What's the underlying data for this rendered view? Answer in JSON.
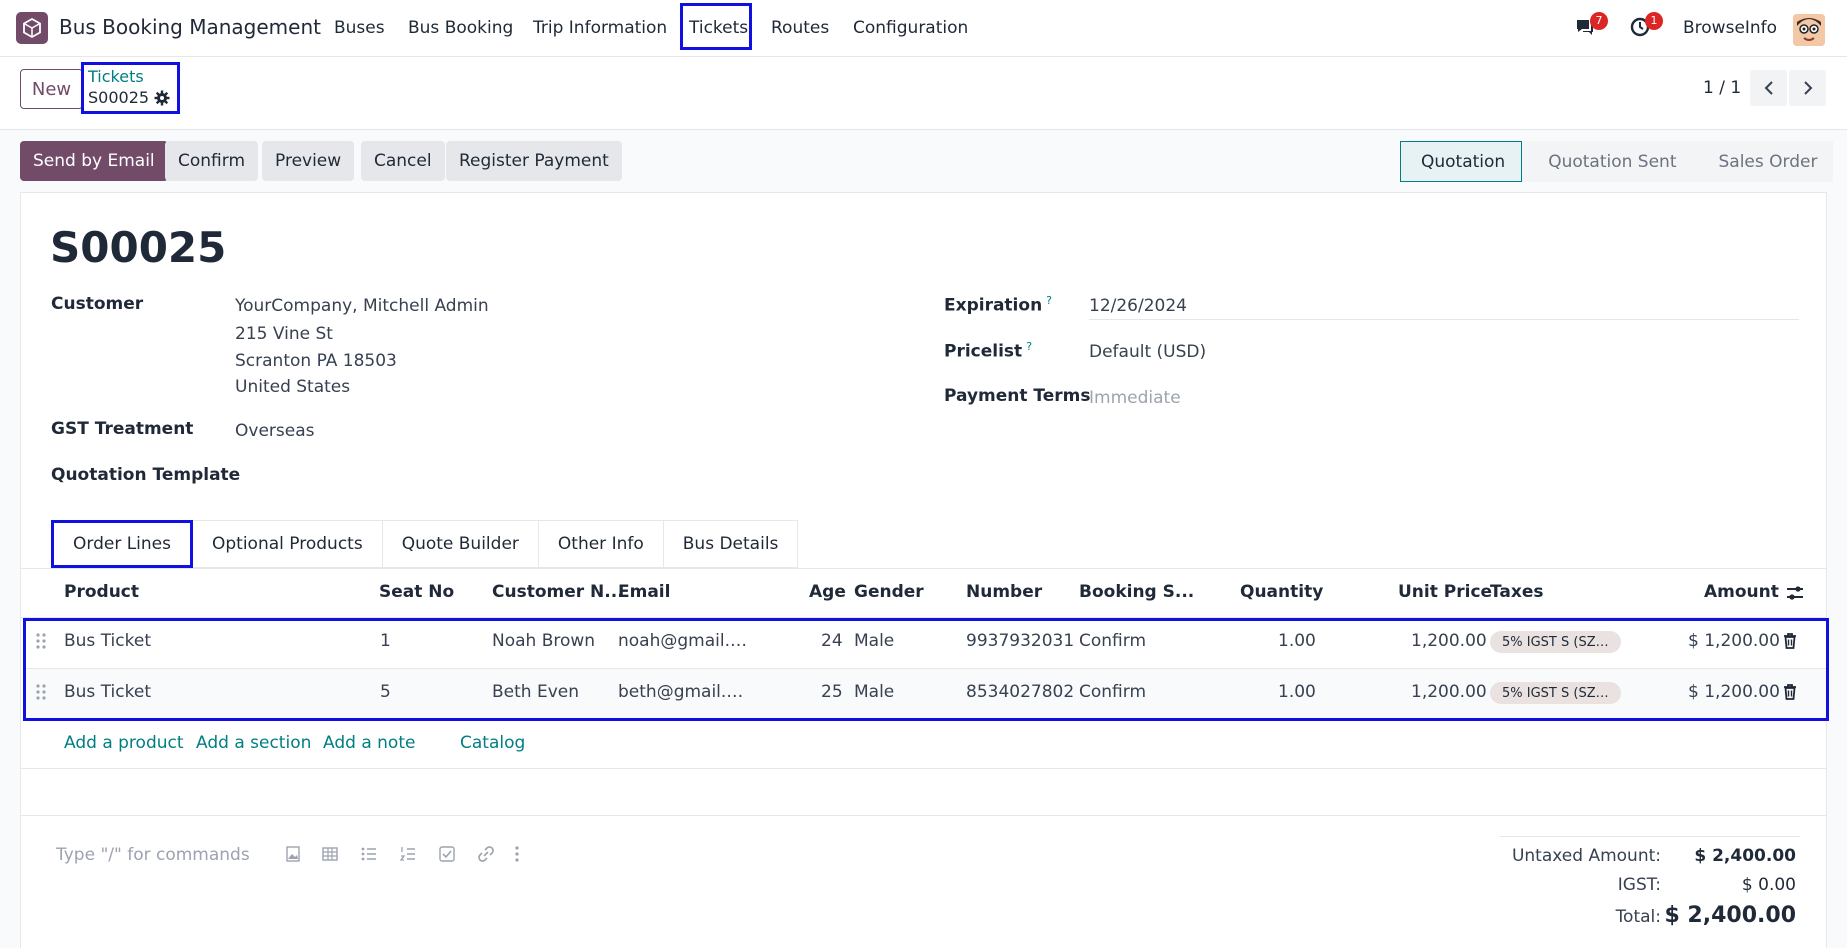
{
  "app": {
    "title": "Bus Booking Management",
    "menu": [
      "Buses",
      "Bus Booking",
      "Trip Information",
      "Tickets",
      "Routes",
      "Configuration"
    ],
    "messages_badge": "7",
    "activities_badge": "1",
    "user_name": "BrowseInfo"
  },
  "control_panel": {
    "new_label": "New",
    "breadcrumb_parent": "Tickets",
    "breadcrumb_current": "S00025",
    "pager": "1 / 1"
  },
  "actions": {
    "send_email": "Send by Email",
    "confirm": "Confirm",
    "preview": "Preview",
    "cancel": "Cancel",
    "register_payment": "Register Payment"
  },
  "status": [
    "Quotation",
    "Quotation Sent",
    "Sales Order"
  ],
  "status_active": "Quotation",
  "form": {
    "name": "S00025",
    "customer_label": "Customer",
    "customer_lines": [
      "YourCompany, Mitchell Admin",
      "215 Vine St",
      "Scranton PA 18503",
      "United States"
    ],
    "gst_label": "GST Treatment",
    "gst_value": "Overseas",
    "template_label": "Quotation Template",
    "expiration_label": "Expiration",
    "expiration_value": "12/26/2024",
    "pricelist_label": "Pricelist",
    "pricelist_value": "Default (USD)",
    "payment_terms_label": "Payment Terms",
    "payment_terms_placeholder": "Immediate",
    "help_mark": "?"
  },
  "tabs": [
    "Order Lines",
    "Optional Products",
    "Quote Builder",
    "Other Info",
    "Bus Details"
  ],
  "table": {
    "headers": {
      "product": "Product",
      "seat": "Seat No",
      "customer": "Customer N...",
      "email": "Email",
      "age": "Age",
      "gender": "Gender",
      "number": "Number",
      "booking": "Booking S...",
      "quantity": "Quantity",
      "unit_price": "Unit Price",
      "taxes": "Taxes",
      "amount": "Amount"
    },
    "rows": [
      {
        "product": "Bus Ticket",
        "seat": "1",
        "customer": "Noah Brown",
        "email": "noah@gmail.…",
        "age": "24",
        "gender": "Male",
        "number": "9937932031",
        "booking": "Confirm",
        "quantity": "1.00",
        "unit_price": "1,200.00",
        "tax": "5% IGST S (SZ…",
        "amount": "$ 1,200.00"
      },
      {
        "product": "Bus Ticket",
        "seat": "5",
        "customer": "Beth Even",
        "email": "beth@gmail.…",
        "age": "25",
        "gender": "Male",
        "number": "8534027802",
        "booking": "Confirm",
        "quantity": "1.00",
        "unit_price": "1,200.00",
        "tax": "5% IGST S (SZ…",
        "amount": "$ 1,200.00"
      }
    ],
    "add_product": "Add a product",
    "add_section": "Add a section",
    "add_note": "Add a note",
    "catalog": "Catalog"
  },
  "footer": {
    "note_placeholder": "Type \"/\" for commands",
    "untaxed_label": "Untaxed Amount:",
    "untaxed_value": "$ 2,400.00",
    "igst_label": "IGST:",
    "igst_value": "$ 0.00",
    "total_label": "Total:",
    "total_value": "$ 2,400.00"
  },
  "colors": {
    "brand": "#714b67",
    "link": "#017e84",
    "highlight": "#1010e0",
    "badge": "#dc2626"
  }
}
